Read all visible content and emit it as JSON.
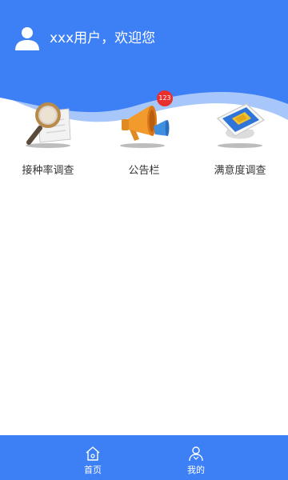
{
  "header": {
    "welcome_text": "xxx用户，欢迎您"
  },
  "tiles": [
    {
      "label": "接种率调查",
      "icon": "magnifier-document-icon"
    },
    {
      "label": "公告栏",
      "icon": "megaphone-icon",
      "badge": "123"
    },
    {
      "label": "满意度调查",
      "icon": "tablet-survey-icon"
    }
  ],
  "tabbar": {
    "items": [
      {
        "label": "首页",
        "icon": "home-icon"
      },
      {
        "label": "我的",
        "icon": "person-icon"
      }
    ]
  },
  "colors": {
    "primary": "#3d7ff5",
    "light_wave": "#9cc1fb",
    "badge": "#e8312e",
    "label_text": "#333333"
  }
}
